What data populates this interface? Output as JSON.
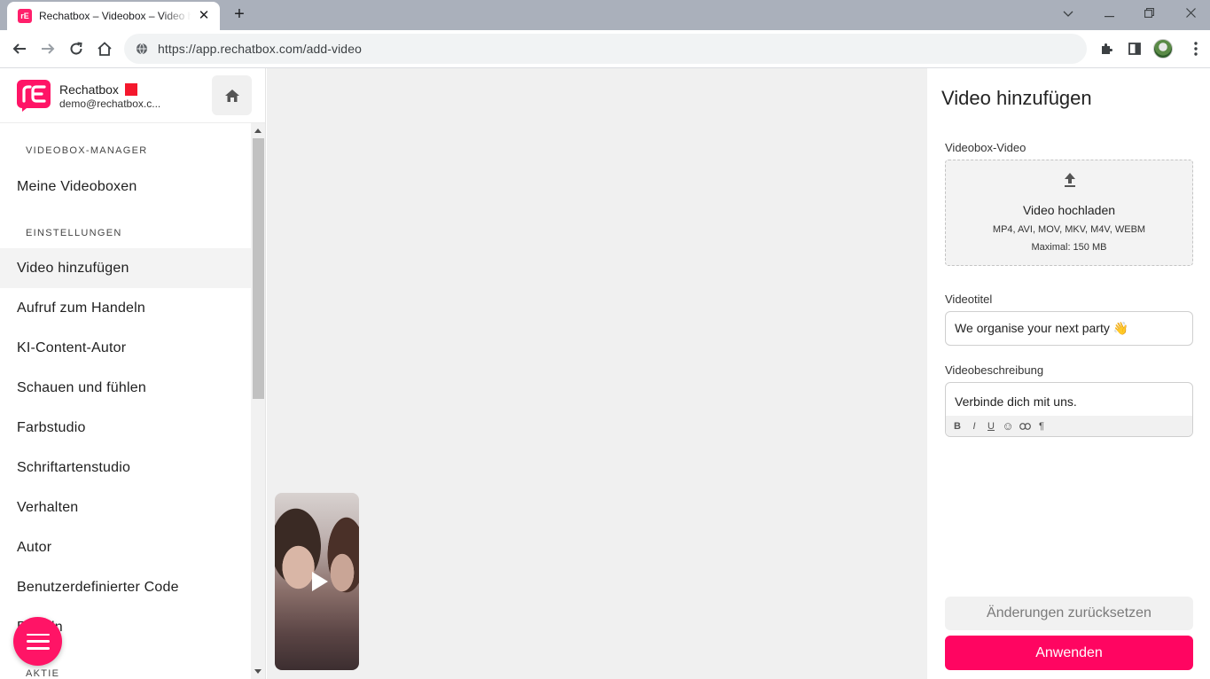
{
  "browser": {
    "tab_title": "Rechatbox – Videobox – Video hinzufügen",
    "tab_favicon_text": "rE",
    "new_tab_symbol": "+",
    "close_symbol": "✕",
    "url": "https://app.rechatbox.com/add-video",
    "icons": [
      "back-icon",
      "forward-icon",
      "reload-icon",
      "home-icon",
      "site-info-icon",
      "extensions-icon",
      "side-panel-icon",
      "profile-avatar",
      "menu-icon"
    ]
  },
  "brand": {
    "name": "Rechatbox",
    "email": "demo@rechatbox.c...",
    "accent_color": "#ff1466",
    "badge_color": "#f4182d"
  },
  "sidebar": {
    "sections": [
      {
        "label": "VIDEOBOX-MANAGER"
      },
      {
        "label": "EINSTELLUNGEN"
      },
      {
        "label": "AKTIE"
      }
    ],
    "items": [
      {
        "label": "Meine Videoboxen"
      },
      {
        "label": "Video hinzufügen",
        "active": true
      },
      {
        "label": "Aufruf zum Handeln"
      },
      {
        "label": "KI-Content-Autor"
      },
      {
        "label": "Schauen und fühlen"
      },
      {
        "label": "Farbstudio"
      },
      {
        "label": "Schriftartenstudio"
      },
      {
        "label": "Verhalten"
      },
      {
        "label": "Autor"
      },
      {
        "label": "Benutzerdefinierter Code"
      },
      {
        "label": "Regeln"
      }
    ]
  },
  "panel": {
    "title": "Video hinzufügen",
    "video_label": "Videobox-Video",
    "upload": {
      "title": "Video hochladen",
      "formats": "MP4, AVI, MOV, MKV, M4V, WEBM",
      "max": "Maximal: 150 MB"
    },
    "title_label": "Videotitel",
    "title_value": "We organise your next party 👋",
    "description_label": "Videobeschreibung",
    "description_value": "Verbinde dich mit uns.",
    "rte_tools": [
      "B",
      "I",
      "U",
      "☺",
      "🔗",
      "¶"
    ],
    "reset_label": "Änderungen zurücksetzen",
    "apply_label": "Anwenden",
    "apply_color": "#ff0561"
  }
}
